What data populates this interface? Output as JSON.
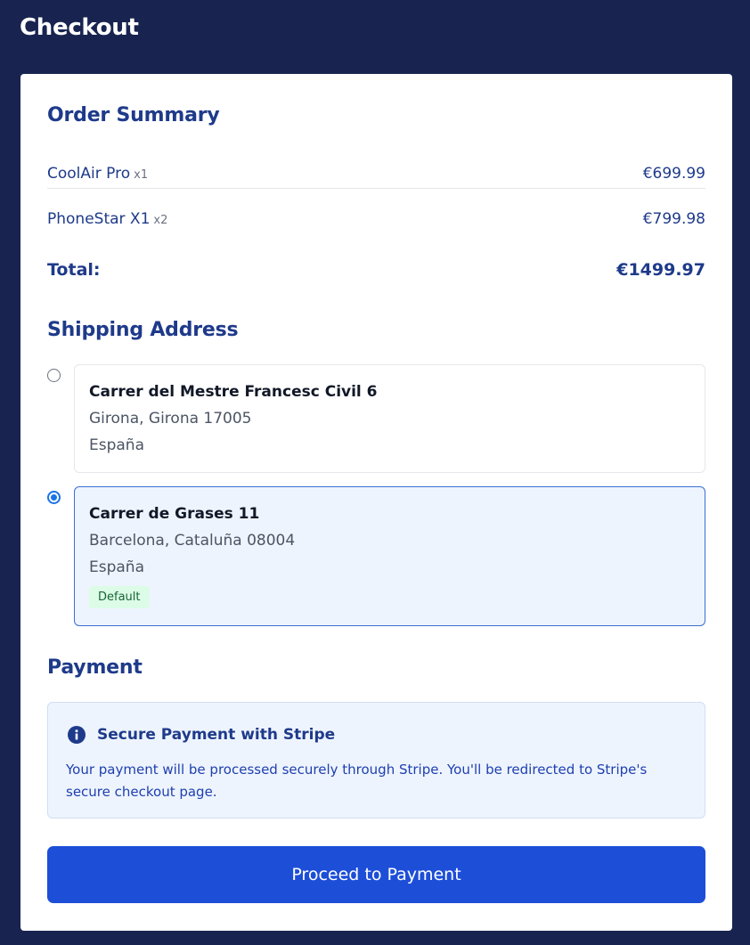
{
  "header": {
    "title": "Checkout"
  },
  "order_summary": {
    "title": "Order Summary",
    "items": [
      {
        "name": "CoolAir Pro",
        "qty": "x1",
        "price": "€699.99"
      },
      {
        "name": "PhoneStar X1",
        "qty": "x2",
        "price": "€799.98"
      }
    ],
    "total_label": "Total:",
    "total_value": "€1499.97"
  },
  "shipping": {
    "title": "Shipping Address",
    "addresses": [
      {
        "street": "Carrer del Mestre Francesc Civil 6",
        "city_line": "Girona, Girona 17005",
        "country": "España",
        "selected": false
      },
      {
        "street": "Carrer de Grases 11",
        "city_line": "Barcelona, Cataluña 08004",
        "country": "España",
        "selected": true,
        "badge": "Default"
      }
    ]
  },
  "payment": {
    "title": "Payment",
    "info_title": "Secure Payment with Stripe",
    "info_text": "Your payment will be processed securely through Stripe. You'll be redirected to Stripe's secure checkout page.",
    "icon": "info-icon"
  },
  "actions": {
    "proceed_label": "Proceed to Payment"
  },
  "colors": {
    "header_bg": "#18244f",
    "accent": "#1d4ed8",
    "heading": "#1e3a8a"
  }
}
